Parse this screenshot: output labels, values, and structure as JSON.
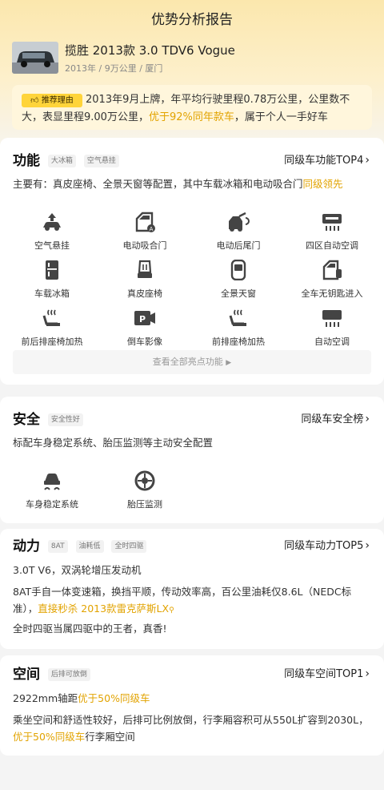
{
  "header": {
    "title": "优势分析报告"
  },
  "car": {
    "name": "揽胜 2013款 3.0 TDV6 Vogue",
    "meta": "2013年 / 9万公里 / 厦门"
  },
  "reason": {
    "badge": "推荐理由",
    "text_a": "2013年9月上牌，年平均行驶里程0.78万公里，公里数不大，表显里程9.00万公里，",
    "highlight": "优于92%同年款车",
    "text_b": "，属于个人一手好车"
  },
  "features": {
    "title": "功能",
    "tags": [
      "大冰箱",
      "空气悬挂"
    ],
    "rank": "同级车功能TOP4",
    "summary_a": "主要有：真皮座椅、全景天窗等配置，其中车载冰箱和电动吸合门",
    "summary_hl": "同级领先",
    "items": [
      {
        "label": "空气悬挂",
        "icon": "air-suspension-icon"
      },
      {
        "label": "电动吸合门",
        "icon": "soft-close-door-icon"
      },
      {
        "label": "电动后尾门",
        "icon": "power-tailgate-icon"
      },
      {
        "label": "四区自动空调",
        "icon": "four-zone-ac-icon"
      },
      {
        "label": "车载冰箱",
        "icon": "car-fridge-icon"
      },
      {
        "label": "真皮座椅",
        "icon": "leather-seat-icon"
      },
      {
        "label": "全景天窗",
        "icon": "panoramic-sunroof-icon"
      },
      {
        "label": "全车无钥匙进入",
        "icon": "keyless-entry-icon"
      },
      {
        "label": "前后排座椅加热",
        "icon": "seat-heating-icon"
      },
      {
        "label": "倒车影像",
        "icon": "parking-camera-icon"
      },
      {
        "label": "前排座椅加热",
        "icon": "front-seat-heating-icon"
      },
      {
        "label": "自动空调",
        "icon": "auto-ac-icon"
      }
    ],
    "see_all": "查看全部亮点功能"
  },
  "safety": {
    "title": "安全",
    "tags": [
      "安全性好"
    ],
    "rank": "同级车安全榜",
    "summary": "标配车身稳定系统、胎压监测等主动安全配置",
    "items": [
      {
        "label": "车身稳定系统",
        "icon": "stability-control-icon"
      },
      {
        "label": "胎压监测",
        "icon": "tire-pressure-icon"
      }
    ]
  },
  "power": {
    "title": "动力",
    "tags": [
      "8AT",
      "油耗低",
      "全时四驱"
    ],
    "rank": "同级车动力TOP5",
    "line1": "3.0T V6，双涡轮增压发动机",
    "line2": "8AT手自一体变速箱，换挡平顺，传动效率高，百公里油耗仅8.6L（NEDC标准），",
    "line2_hl": "直接秒杀 2013款雷克萨斯LX",
    "line3": "全时四驱当属四驱中的王者，真香!"
  },
  "space": {
    "title": "空间",
    "tags": [
      "后排可放倒"
    ],
    "rank": "同级车空间TOP1",
    "line1_a": "2922mm轴距",
    "line1_hl": "优于50%同级车",
    "line2_a": "乘坐空间和舒适性较好，后排可比例放倒，行李厢容积可从550L扩容到2030L，",
    "line2_hl": "优于50%同级车",
    "line2_b": "行李厢空间"
  },
  "colors": {
    "accent": "#e2a300",
    "badge": "#ffd43a",
    "hero": "#fbe7ad"
  }
}
